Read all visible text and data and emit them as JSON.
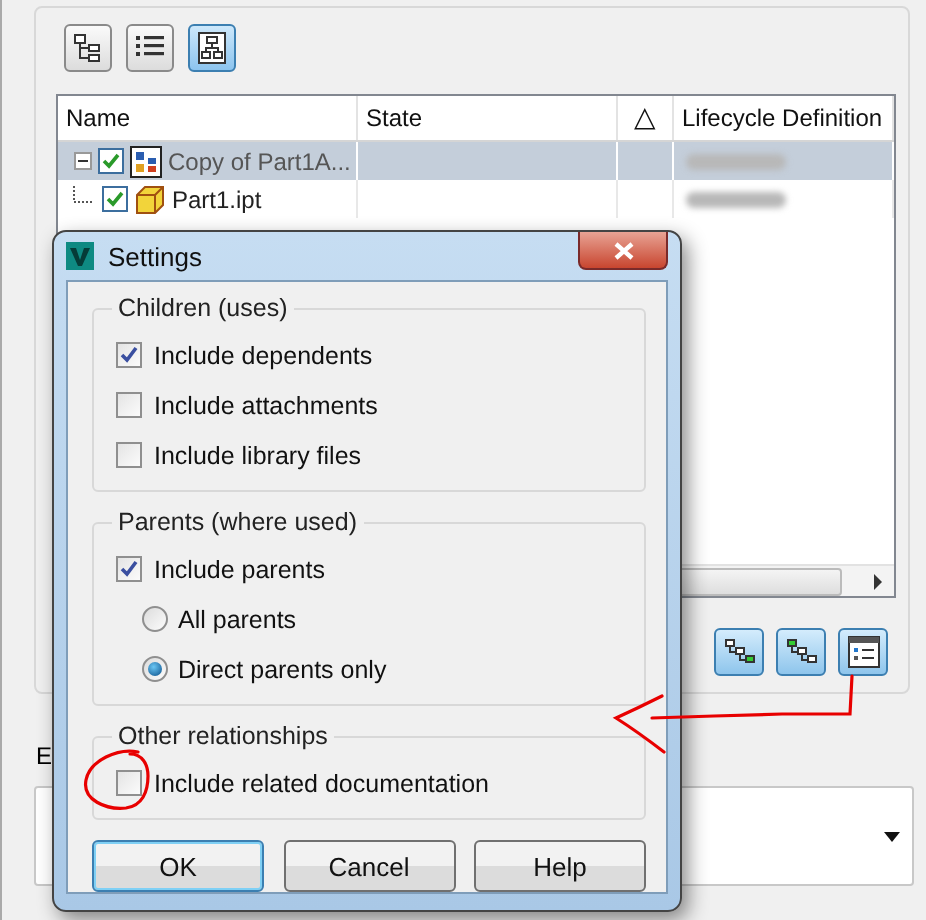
{
  "toolbar": {
    "buttons": [
      {
        "kind": "tree",
        "selected": false
      },
      {
        "kind": "list",
        "selected": false
      },
      {
        "kind": "diagram",
        "selected": true
      }
    ]
  },
  "table": {
    "columns": [
      "Name",
      "State",
      "△",
      "Lifecycle Definition"
    ],
    "rows": [
      {
        "name": "Copy of Part1A...",
        "kind": "assembly",
        "checked": true,
        "expanded": true,
        "selected": true,
        "lifecycle_blurred": true,
        "children": [
          {
            "name": "Part1.ipt",
            "kind": "part",
            "checked": true,
            "selected": false,
            "lifecycle_blurred": true
          }
        ]
      }
    ]
  },
  "view_buttons": [
    {
      "kind": "tree-green-bottom"
    },
    {
      "kind": "tree-green-top"
    },
    {
      "kind": "details"
    }
  ],
  "section_label": "E",
  "dialog": {
    "title": "Settings",
    "groups": [
      {
        "title": "Children (uses)",
        "options": [
          {
            "kind": "checkbox",
            "label": "Include dependents",
            "checked": true
          },
          {
            "kind": "checkbox",
            "label": "Include attachments",
            "checked": false
          },
          {
            "kind": "checkbox",
            "label": "Include library files",
            "checked": false
          }
        ]
      },
      {
        "title": "Parents (where used)",
        "options": [
          {
            "kind": "checkbox",
            "label": "Include parents",
            "checked": true,
            "children": [
              {
                "kind": "radio",
                "label": "All parents",
                "selected": false
              },
              {
                "kind": "radio",
                "label": "Direct parents only",
                "selected": true
              }
            ]
          }
        ]
      },
      {
        "title": "Other relationships",
        "options": [
          {
            "kind": "checkbox",
            "label": "Include related documentation",
            "checked": false
          }
        ]
      }
    ],
    "buttons": [
      {
        "label": "OK",
        "default": true
      },
      {
        "label": "Cancel",
        "default": false
      },
      {
        "label": "Help",
        "default": false
      }
    ]
  }
}
